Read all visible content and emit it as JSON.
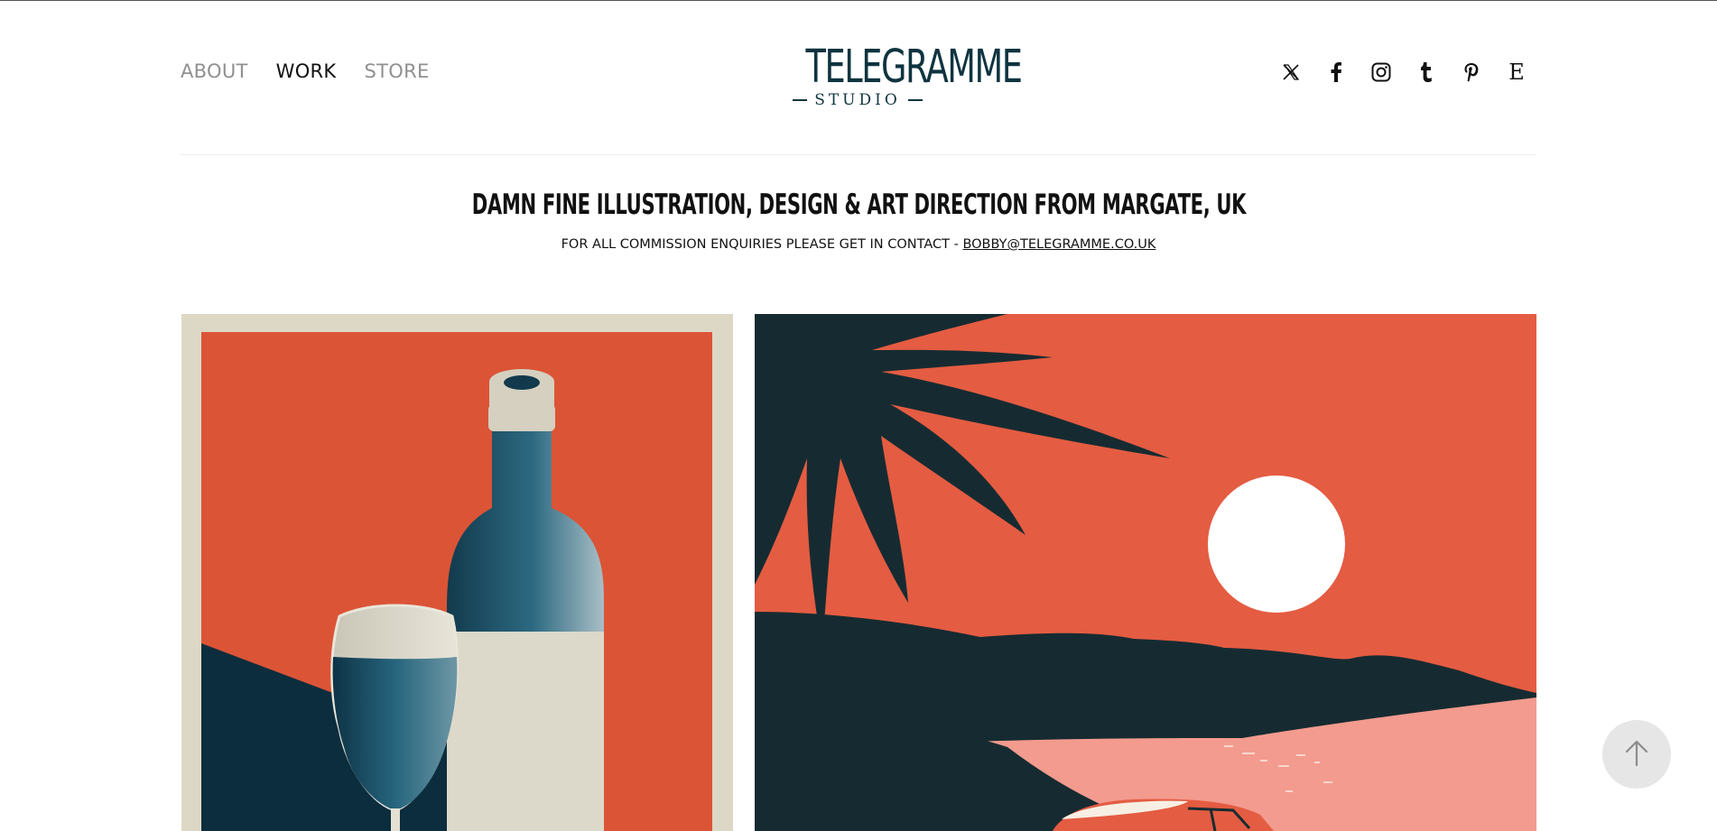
{
  "nav": {
    "about": "ABOUT",
    "work": "WORK",
    "store": "STORE"
  },
  "logo": {
    "main": "TELEGRAMME",
    "sub": "STUDIO"
  },
  "social": [
    "x-icon",
    "facebook-icon",
    "instagram-icon",
    "tumblr-icon",
    "pinterest-icon",
    "etsy-icon"
  ],
  "hero": {
    "headline": "DAMN FINE ILLUSTRATION, DESIGN & ART DIRECTION FROM MARGATE, UK",
    "contact_prefix": "FOR ALL COMMISSION ENQUIRIES PLEASE GET IN CONTACT - ",
    "contact_email": "BOBBY@TELEGRAMME.CO.UK"
  },
  "colors": {
    "brand": "#0f3440",
    "poster_orange": "#db5436",
    "poster_navy": "#0c2d3d",
    "sunset_orange": "#e45c42",
    "sea_pink": "#f29b8e",
    "palm_dark": "#162b31",
    "cream": "#ddd8c6"
  }
}
